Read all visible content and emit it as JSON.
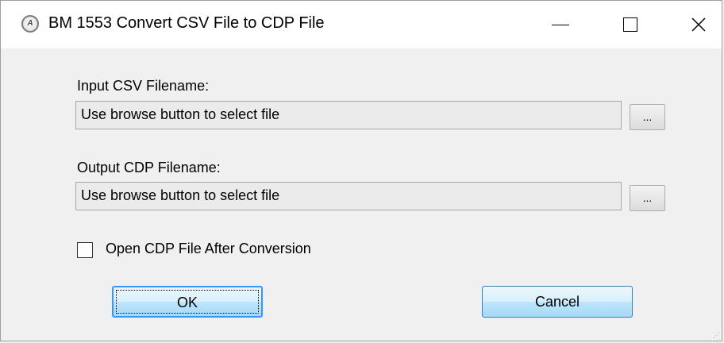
{
  "window": {
    "title": "BM 1553 Convert CSV File to CDP File",
    "app_icon_text": "A",
    "controls": {
      "minimize": "—",
      "close": "✕"
    }
  },
  "form": {
    "input_label": "Input CSV Filename:",
    "input_value": "Use browse button to select file",
    "input_browse_label": "...",
    "output_label": "Output CDP Filename:",
    "output_value": "Use browse button to select file",
    "output_browse_label": "...",
    "open_after_label": "Open CDP File After Conversion",
    "open_after_checked": false
  },
  "buttons": {
    "ok_label": "OK",
    "cancel_label": "Cancel"
  },
  "colors": {
    "accent": "#3399ff",
    "button_border": "#3c7fb1",
    "field_background": "#ebebeb",
    "window_background": "#f0f0f0"
  },
  "icons": {
    "app": "app-logo-icon",
    "minimize": "minimize-icon",
    "maximize": "maximize-icon",
    "close": "close-icon",
    "resize": "resize-grip-icon"
  }
}
